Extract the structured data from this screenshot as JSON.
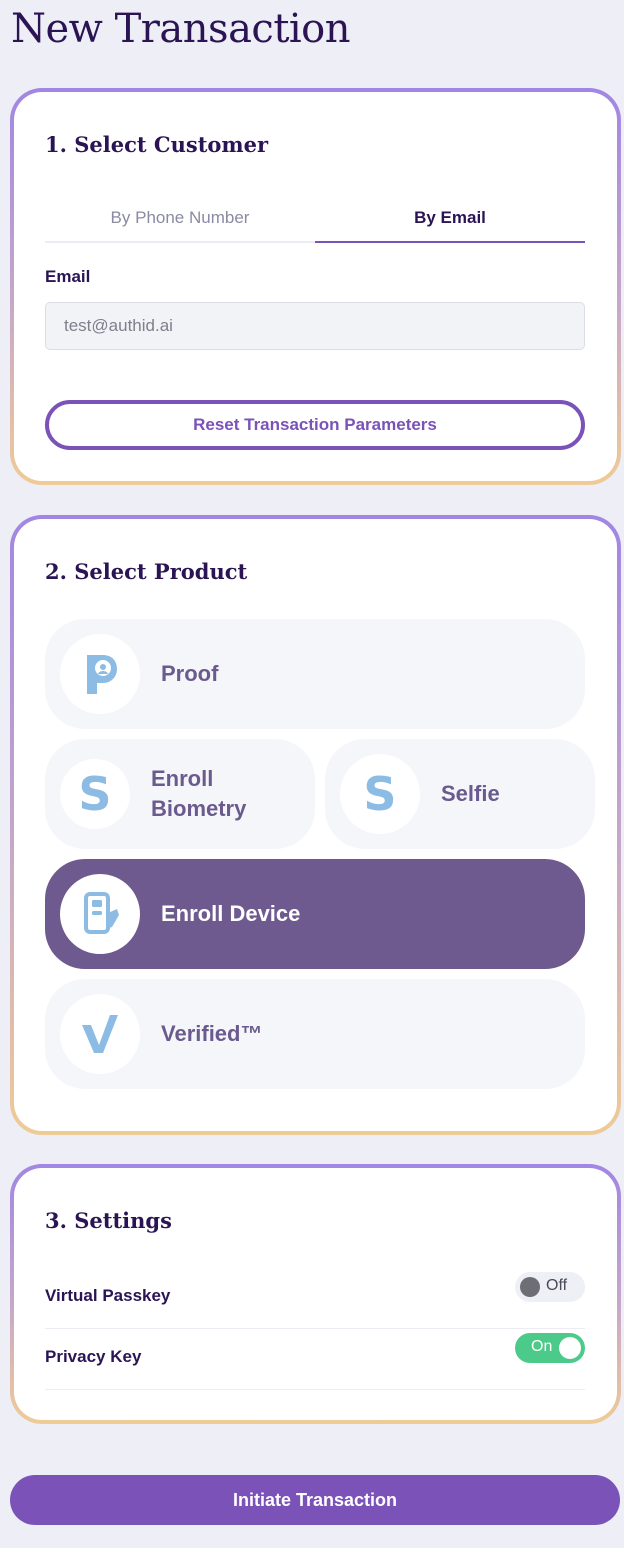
{
  "page": {
    "title": "New Transaction"
  },
  "customer": {
    "heading": "1. Select Customer",
    "tabs": [
      {
        "label": "By Phone Number",
        "active": false
      },
      {
        "label": "By Email",
        "active": true
      }
    ],
    "email_label": "Email",
    "email_value": "test@authid.ai",
    "reset_label": "Reset Transaction Parameters"
  },
  "product": {
    "heading": "2. Select Product",
    "items": [
      {
        "label": "Proof",
        "icon": "proof-p-icon",
        "selected": false
      },
      {
        "label": "Enroll Biometry",
        "icon": "enroll-s-icon",
        "selected": false
      },
      {
        "label": "Selfie",
        "icon": "selfie-s-icon",
        "selected": false
      },
      {
        "label": "Enroll Device",
        "icon": "device-icon",
        "selected": true
      },
      {
        "label": "Verified™",
        "icon": "verified-check-icon",
        "selected": false
      }
    ]
  },
  "settings": {
    "heading": "3. Settings",
    "items": [
      {
        "label": "Virtual Passkey",
        "state": "Off"
      },
      {
        "label": "Privacy Key",
        "state": "On"
      }
    ]
  },
  "actions": {
    "initiate_label": "Initiate Transaction"
  },
  "colors": {
    "accent": "#7b52b8",
    "selected_product": "#6e5a8e",
    "toggle_on": "#4cca8a",
    "icon_blue": "#8cbce3"
  }
}
